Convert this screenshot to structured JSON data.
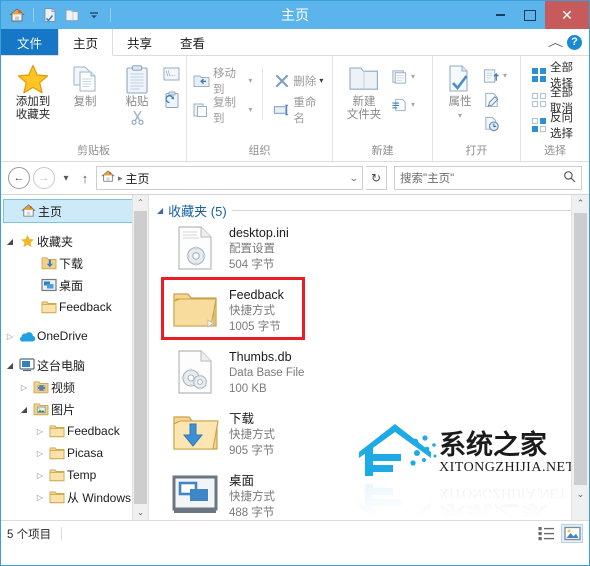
{
  "window": {
    "title": "主页",
    "quick_access": [
      {
        "name": "home-icon",
        "label": "主页"
      },
      {
        "name": "properties-icon",
        "label": "属性"
      },
      {
        "name": "new-folder-icon",
        "label": "新建文件夹"
      },
      {
        "name": "customize-dropdown-icon",
        "label": "自定义快速访问工具栏"
      }
    ],
    "controls": {
      "minimize": "—",
      "maximize": "□",
      "close": "✕"
    }
  },
  "tabs": [
    {
      "label": "文件",
      "type": "file"
    },
    {
      "label": "主页",
      "type": "active"
    },
    {
      "label": "共享",
      "type": "normal"
    },
    {
      "label": "查看",
      "type": "normal"
    }
  ],
  "tabbar_right": {
    "collapse": "︿",
    "help": "?"
  },
  "ribbon": {
    "groups": [
      {
        "label": "剪贴板",
        "big": [
          {
            "label": "添加到\n收藏夹",
            "line1": "添加到",
            "line2": "收藏夹",
            "icon": "star-icon",
            "enabled": true
          },
          {
            "label": "复制",
            "line1": "复制",
            "line2": "",
            "icon": "copy-icon",
            "enabled": false
          },
          {
            "label": "粘贴",
            "line1": "粘贴",
            "line2": "",
            "icon": "paste-icon",
            "enabled": false
          }
        ],
        "small": [
          {
            "label": "剪切",
            "icon": "cut-icon"
          },
          {
            "label": "复制路径",
            "icon": "copy-path-icon"
          },
          {
            "label": "粘贴快捷方式",
            "icon": "paste-shortcut-icon"
          }
        ]
      },
      {
        "label": "组织",
        "items": [
          {
            "label": "移动到",
            "icon": "move-to-icon",
            "caret": true
          },
          {
            "label": "复制到",
            "icon": "copy-to-icon",
            "caret": true
          },
          {
            "label": "删除",
            "icon": "delete-icon",
            "caret": true
          },
          {
            "label": "重命名",
            "icon": "rename-icon",
            "caret": false
          }
        ]
      },
      {
        "label": "新建",
        "big": [
          {
            "line1": "新建",
            "line2": "文件夹",
            "icon": "new-folder-icon",
            "enabled": false
          }
        ],
        "small": [
          {
            "label": "新建项目",
            "icon": "new-item-icon",
            "caret": true
          },
          {
            "label": "轻松访问",
            "icon": "easy-access-icon",
            "caret": true
          }
        ]
      },
      {
        "label": "打开",
        "big": [
          {
            "line1": "属性",
            "line2": "",
            "icon": "properties-icon",
            "enabled": false,
            "caret": true
          }
        ],
        "small": [
          {
            "label": "打开",
            "icon": "open-icon",
            "caret": true
          },
          {
            "label": "编辑",
            "icon": "edit-icon",
            "caret": false
          },
          {
            "label": "历史记录",
            "icon": "history-icon",
            "caret": false
          }
        ]
      },
      {
        "label": "选择",
        "items": [
          {
            "label": "全部选择",
            "icon": "select-all-icon"
          },
          {
            "label": "全部取消",
            "icon": "select-none-icon"
          },
          {
            "label": "反向选择",
            "icon": "invert-selection-icon"
          }
        ]
      }
    ]
  },
  "addressbar": {
    "back": "←",
    "forward": "→",
    "recent": "▾",
    "up": "↑",
    "crumb_icon": "home-icon",
    "crumb": "主页",
    "crumb_sep": "▸",
    "dropdown": "⌄",
    "refresh": "↻",
    "search_placeholder": "搜索\"主页\"",
    "search_value": "",
    "search_icon": "magnifier-icon"
  },
  "sidebar": {
    "items": [
      {
        "label": "主页",
        "icon": "home-icon",
        "indent": 0,
        "twisty": "none",
        "selected": true
      },
      {
        "label": "收藏夹",
        "icon": "star-icon",
        "indent": 0,
        "twisty": "open",
        "selected": false
      },
      {
        "label": "下载",
        "icon": "downloads-folder-icon",
        "indent": 1,
        "twisty": "none",
        "selected": false
      },
      {
        "label": "桌面",
        "icon": "desktop-icon",
        "indent": 1,
        "twisty": "none",
        "selected": false
      },
      {
        "label": "Feedback",
        "icon": "folder-icon",
        "indent": 1,
        "twisty": "none",
        "selected": false
      },
      {
        "label": "OneDrive",
        "icon": "onedrive-icon",
        "indent": 0,
        "twisty": "closed",
        "selected": false
      },
      {
        "label": "这台电脑",
        "icon": "computer-icon",
        "indent": 0,
        "twisty": "open",
        "selected": false
      },
      {
        "label": "视频",
        "icon": "videos-folder-icon",
        "indent": 1,
        "twisty": "closed",
        "selected": false
      },
      {
        "label": "图片",
        "icon": "pictures-folder-icon",
        "indent": 1,
        "twisty": "open",
        "selected": false
      },
      {
        "label": "Feedback",
        "icon": "folder-icon",
        "indent": 2,
        "twisty": "closed",
        "selected": false
      },
      {
        "label": "Picasa",
        "icon": "folder-icon",
        "indent": 2,
        "twisty": "closed",
        "selected": false
      },
      {
        "label": "Temp",
        "icon": "folder-icon",
        "indent": 2,
        "twisty": "closed",
        "selected": false
      },
      {
        "label": "从 Windows",
        "icon": "folder-icon",
        "indent": 2,
        "twisty": "closed",
        "selected": false
      }
    ]
  },
  "content": {
    "group_header": "收藏夹 (5)",
    "group_twisty": "◢",
    "items": [
      {
        "name": "desktop.ini",
        "type": "配置设置",
        "size": "504 字节",
        "icon": "ini-file-icon",
        "highlighted": false
      },
      {
        "name": "Feedback",
        "type": "快捷方式",
        "size": "1005 字节",
        "icon": "folder-shortcut-icon",
        "highlighted": true
      },
      {
        "name": "Thumbs.db",
        "type": "Data Base File",
        "size": "100 KB",
        "icon": "db-file-icon",
        "highlighted": false
      },
      {
        "name": "下载",
        "type": "快捷方式",
        "size": "905 字节",
        "icon": "downloads-folder-icon",
        "highlighted": false
      },
      {
        "name": "桌面",
        "type": "快捷方式",
        "size": "488 字节",
        "icon": "desktop-icon",
        "highlighted": false
      }
    ],
    "watermark": {
      "title": "系统之家",
      "subtitle": "XITONGZHIJIA.NET",
      "color": "#1eaae6"
    },
    "scrollbar": {
      "up": "⌃",
      "down": "⌄"
    }
  },
  "statusbar": {
    "item_count": "5 个项目",
    "views": [
      {
        "name": "details-view-icon",
        "active": false
      },
      {
        "name": "large-icons-view-icon",
        "active": true
      }
    ]
  },
  "colors": {
    "titlebar": "#5bb4ec",
    "file_tab": "#1577c6",
    "close_button": "#c75b5b",
    "accent": "#1a5fa0",
    "highlight_box": "#ec1c24"
  }
}
